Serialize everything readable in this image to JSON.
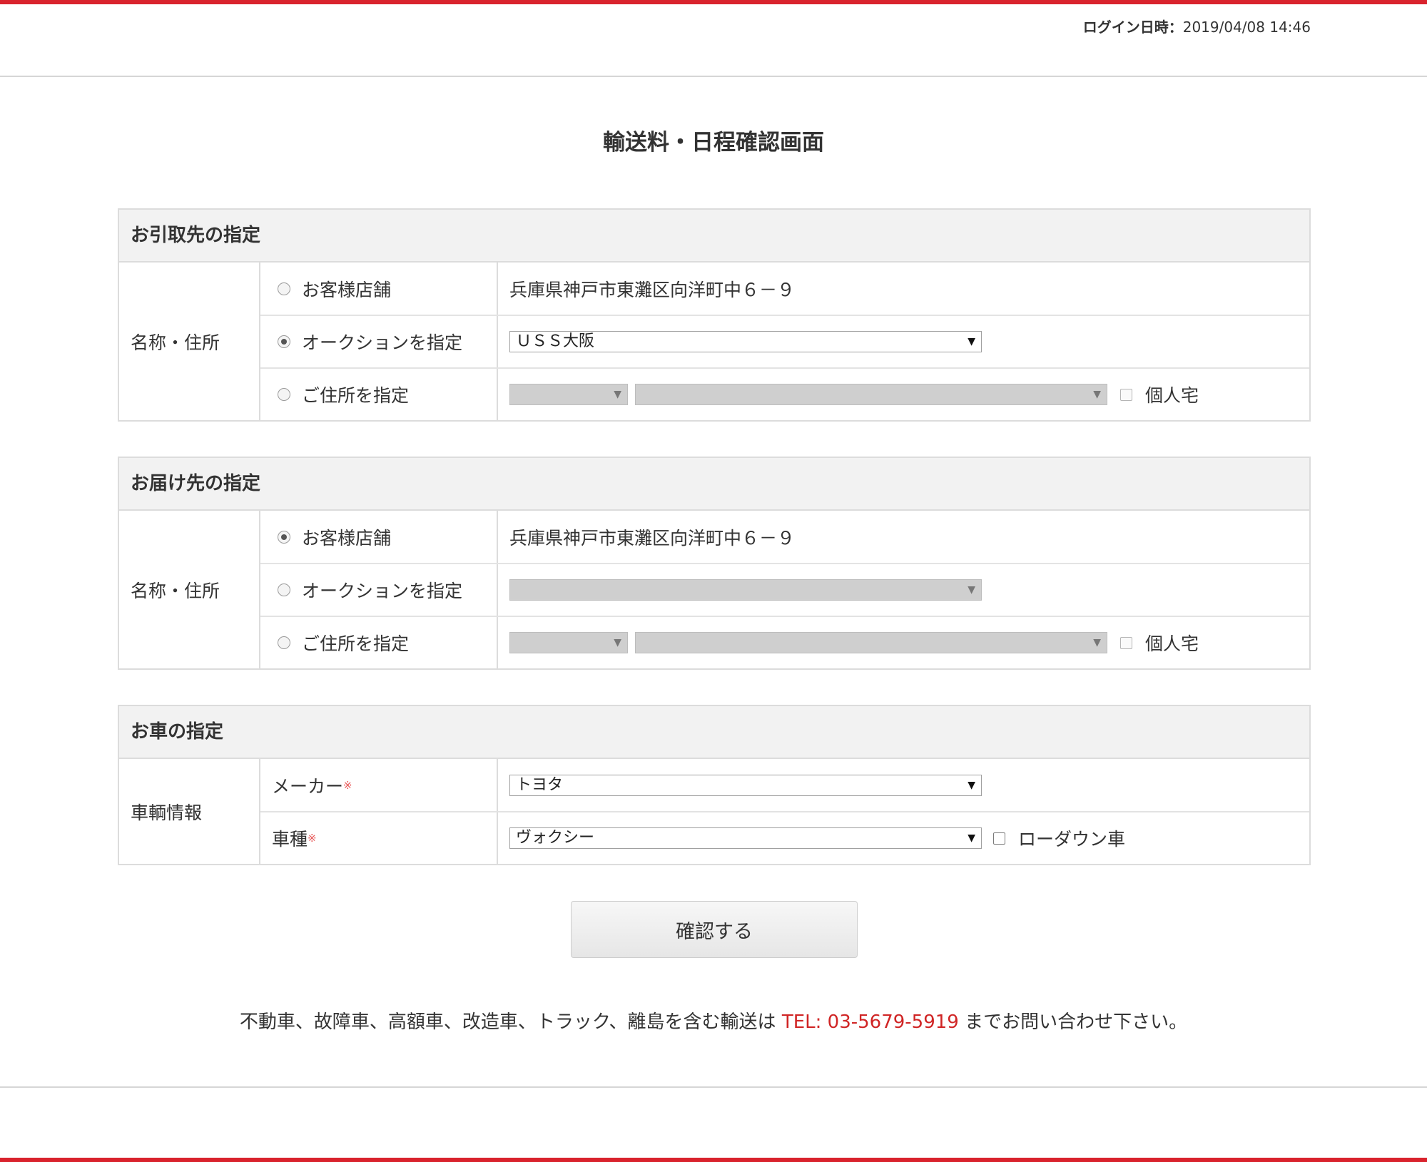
{
  "header": {
    "login_label": "ログイン日時：",
    "login_datetime": "2019/04/08 14:46"
  },
  "page_title": "輸送料・日程確認画面",
  "pickup": {
    "heading": "お引取先の指定",
    "label": "名称・住所",
    "options": [
      {
        "label": "お客様店舗",
        "selected": false,
        "value": "兵庫県神戸市東灘区向洋町中６－９"
      },
      {
        "label": "オークションを指定",
        "selected": true,
        "select_value": "ＵＳＳ大阪"
      },
      {
        "label": "ご住所を指定",
        "selected": false,
        "checkbox_label": "個人宅"
      }
    ]
  },
  "delivery": {
    "heading": "お届け先の指定",
    "label": "名称・住所",
    "options": [
      {
        "label": "お客様店舗",
        "selected": true,
        "value": "兵庫県神戸市東灘区向洋町中６－９"
      },
      {
        "label": "オークションを指定",
        "selected": false,
        "select_value": ""
      },
      {
        "label": "ご住所を指定",
        "selected": false,
        "checkbox_label": "個人宅"
      }
    ]
  },
  "car": {
    "heading": "お車の指定",
    "label": "車輌情報",
    "maker_label": "メーカー",
    "maker_value": "トヨタ",
    "model_label": "車種",
    "model_value": "ヴォクシー",
    "required_mark": "※",
    "lowdown_label": "ローダウン車"
  },
  "confirm_button": "確認する",
  "footer": {
    "text_before": "不動車、故障車、高額車、改造車、トラック、離島を含む輸送は ",
    "tel": "TEL: 03-5679-5919",
    "text_after": " までお問い合わせ下さい。"
  },
  "colors": {
    "accent": "#d9232d",
    "tel": "#d02525"
  }
}
